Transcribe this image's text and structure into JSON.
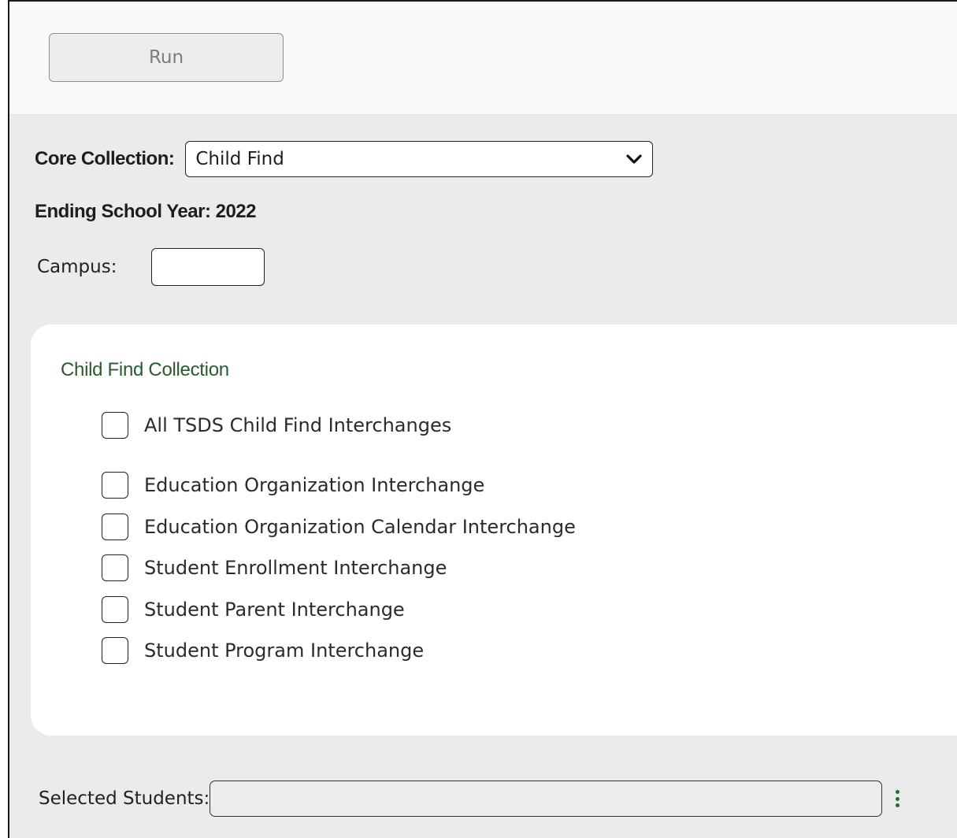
{
  "toolbar": {
    "run_label": "Run"
  },
  "form": {
    "core_collection_label": "Core Collection:",
    "core_collection_value": "Child Find",
    "ending_school_year": "Ending School Year: 2022",
    "campus_label": "Campus:",
    "campus_value": ""
  },
  "panel": {
    "title": "Child Find Collection",
    "all_label": "All TSDS Child Find Interchanges",
    "items": [
      {
        "label": "Education Organization Interchange"
      },
      {
        "label": "Education Organization Calendar Interchange"
      },
      {
        "label": "Student Enrollment Interchange"
      },
      {
        "label": "Student Parent Interchange"
      },
      {
        "label": "Student Program Interchange"
      }
    ]
  },
  "students": {
    "label": "Selected Students:",
    "value": ""
  },
  "icons": {
    "dropdown": "chevron-down-icon",
    "more": "kebab-menu-icon"
  },
  "colors": {
    "accent_green": "#2c6b2e",
    "panel_title": "#2a5a2e"
  }
}
